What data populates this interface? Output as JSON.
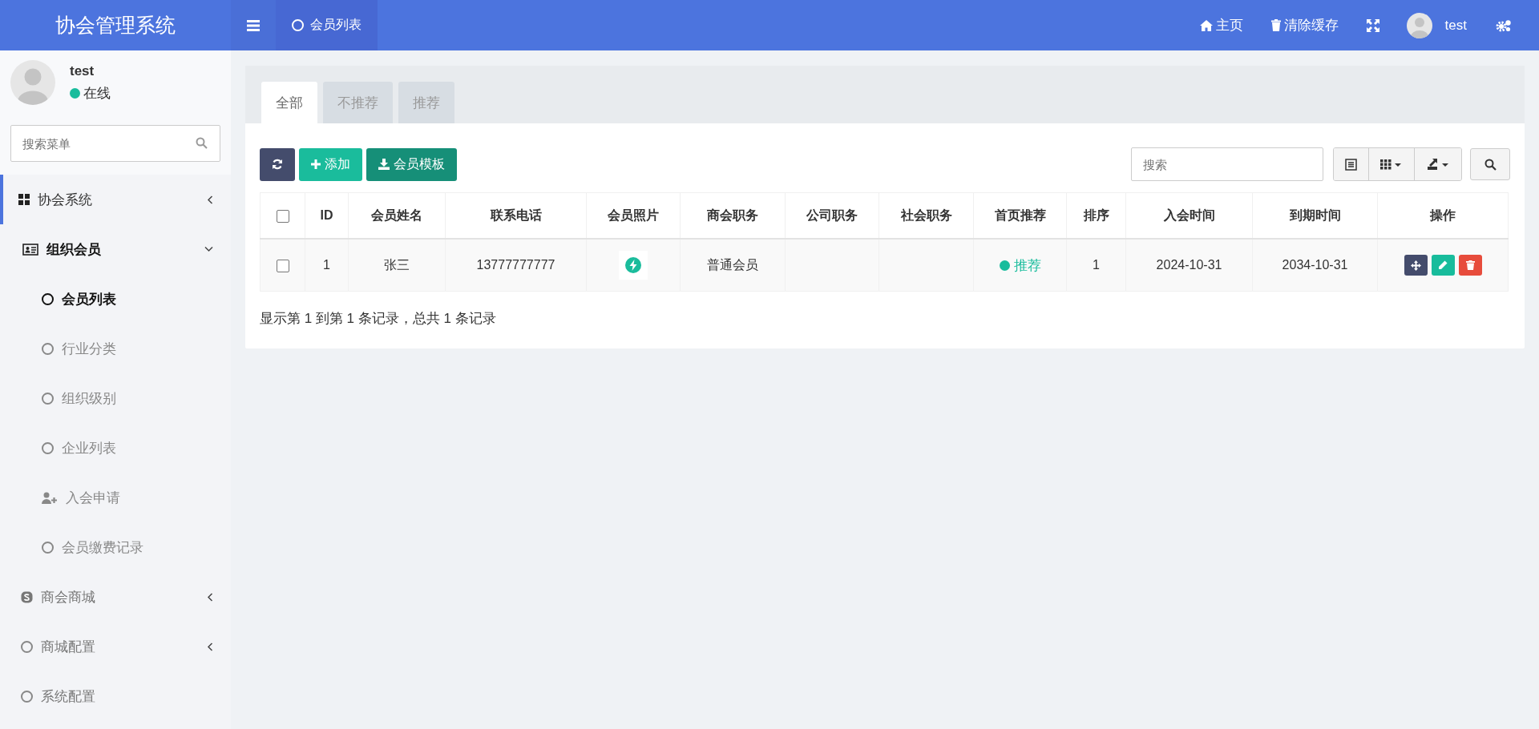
{
  "header": {
    "logo": "协会管理系统",
    "page_tabs": [
      {
        "label": "会员列表",
        "selected": true
      }
    ],
    "links": [
      {
        "label": "主页"
      },
      {
        "label": "清除缓存"
      }
    ],
    "user": "test"
  },
  "sidebar": {
    "user": {
      "name": "test",
      "status": {
        "label": "在线",
        "color": "#18bc9c"
      }
    },
    "search": {
      "placeholder": "搜索菜单"
    },
    "items": [
      {
        "label": "协会系统",
        "selected": true,
        "expanded": false
      },
      {
        "label": "组织会员",
        "selected": false,
        "expanded": true,
        "children": [
          {
            "label": "会员列表",
            "selected": true
          },
          {
            "label": "行业分类",
            "selected": false
          },
          {
            "label": "组织级别",
            "selected": false
          },
          {
            "label": "企业列表",
            "selected": false
          },
          {
            "label": "入会申请",
            "selected": false
          },
          {
            "label": "会员缴费记录",
            "selected": false
          }
        ]
      },
      {
        "label": "商会商城",
        "selected": false,
        "expanded": false
      },
      {
        "label": "商城配置",
        "selected": false,
        "expanded": false
      },
      {
        "label": "系统配置",
        "selected": false
      }
    ]
  },
  "tabs": [
    {
      "label": "全部",
      "selected": true
    },
    {
      "label": "不推荐",
      "selected": false
    },
    {
      "label": "推荐",
      "selected": false
    }
  ],
  "toolbar": {
    "buttons": [
      {
        "kind": "refresh"
      },
      {
        "kind": "add",
        "label": "添加"
      },
      {
        "kind": "download",
        "label": "会员模板"
      }
    ],
    "search": {
      "placeholder": "搜索"
    }
  },
  "table": {
    "select_all_checked": false,
    "columns": [
      "ID",
      "会员姓名",
      "联系电话",
      "会员照片",
      "商会职务",
      "公司职务",
      "社会职务",
      "首页推荐",
      "排序",
      "入会时间",
      "到期时间",
      "操作"
    ],
    "rows": [
      {
        "checked": false,
        "id": "1",
        "name": "张三",
        "phone": "13777777777",
        "position": "普通会员",
        "recommend": {
          "text": "推荐",
          "color": "#18bc9c"
        },
        "sort": "1",
        "join_date": "2024-10-31",
        "expire_date": "2034-10-31"
      }
    ]
  },
  "pagination": {
    "summary": "显示第 1 到第 1 条记录，总共 1 条记录"
  }
}
